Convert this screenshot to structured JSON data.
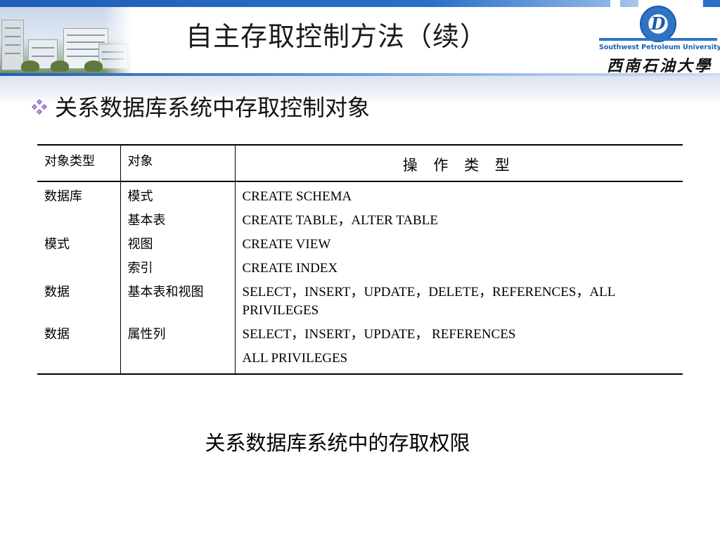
{
  "header": {
    "title": "自主存取控制方法（续）",
    "logo": {
      "english": "Southwest Petroleum University",
      "chinese": "西南石油大學"
    }
  },
  "heading": "关系数据库系统中存取控制对象",
  "table": {
    "headers": [
      "对象类型",
      "对象",
      "操 作 类 型"
    ],
    "rows": [
      {
        "type": "数据库",
        "object": "模式",
        "ops": "CREATE SCHEMA"
      },
      {
        "type": "",
        "object": "基本表",
        "ops": "CREATE TABLE，ALTER TABLE"
      },
      {
        "type": "模式",
        "object": "视图",
        "ops": "CREATE VIEW"
      },
      {
        "type": "",
        "object": "索引",
        "ops": "CREATE INDEX"
      },
      {
        "type": "数据",
        "object": "基本表和视图",
        "ops": "SELECT，INSERT，UPDATE，DELETE，REFERENCES，ALL PRIVILEGES"
      },
      {
        "type": "数据",
        "object": "属性列",
        "ops": "SELECT，INSERT，UPDATE， REFERENCES"
      },
      {
        "type": "",
        "object": "",
        "ops": "ALL PRIVILEGES"
      }
    ]
  },
  "caption": "关系数据库系统中的存取权限",
  "colors": {
    "accent_blue": "#1f5fb8",
    "bullet_purple": "#8a5cc0"
  }
}
